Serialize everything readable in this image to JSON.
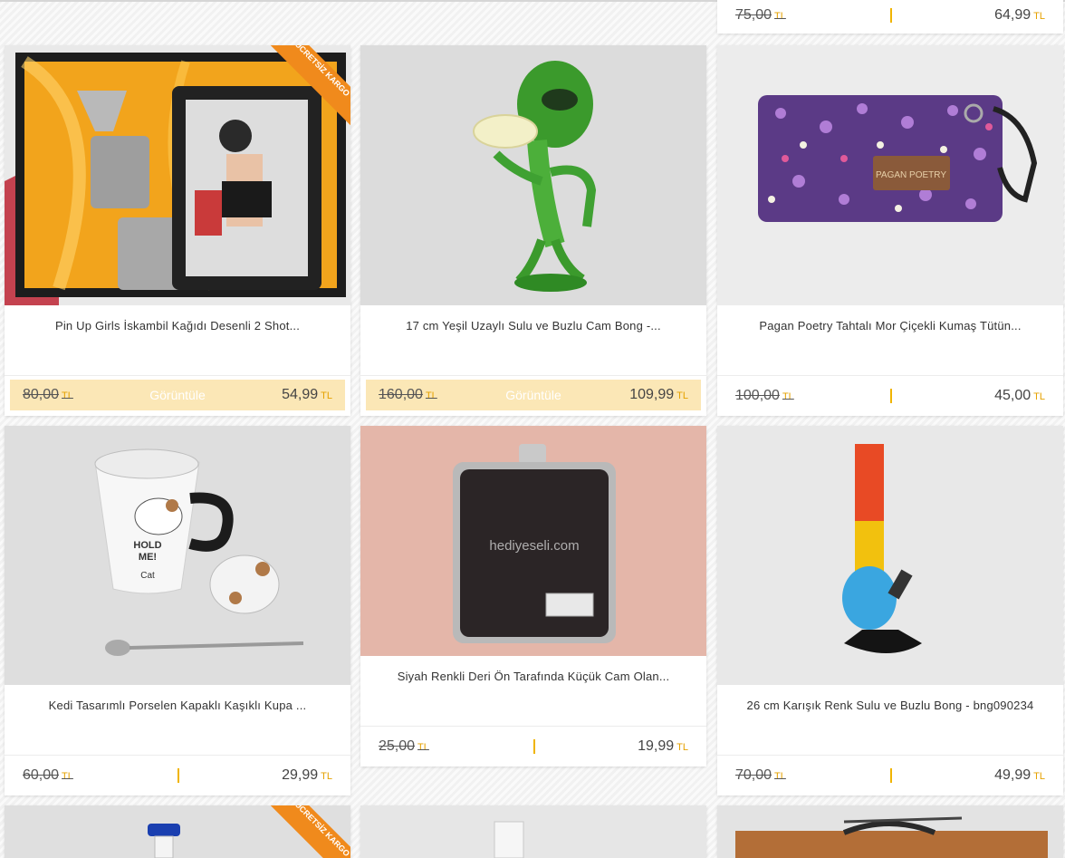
{
  "currency": "TL",
  "view_label": "Görüntüle",
  "ribbon_text": "ÜCRETSİZ KARGO",
  "top_card": {
    "old": "75,00",
    "new": "64,99"
  },
  "products": [
    {
      "title": "Pin Up Girls İskambil Kağıdı Desenli 2 Shot...",
      "old": "80,00",
      "new": "54,99"
    },
    {
      "title": "17 cm Yeşil Uzaylı Sulu ve Buzlu Cam Bong -...",
      "old": "160,00",
      "new": "109,99"
    },
    {
      "title": "Pagan Poetry Tahtalı Mor Çiçekli Kumaş Tütün...",
      "old": "100,00",
      "new": "45,00"
    },
    {
      "title": "Kedi Tasarımlı Porselen Kapaklı Kaşıklı Kupa ...",
      "old": "60,00",
      "new": "29,99"
    },
    {
      "title": "Siyah Renkli Deri Ön Tarafında Küçük Cam Olan...",
      "old": "25,00",
      "new": "19,99"
    },
    {
      "title": "26 cm Karışık Renk Sulu ve Buzlu Bong - bng090234",
      "old": "70,00",
      "new": "49,99"
    }
  ],
  "image_labels": {
    "pouch_patch": "PAGAN POETRY",
    "watermark": "hediyeseli.com",
    "mug_text_1": "HOLD",
    "mug_text_2": "ME!",
    "mug_text_3": "Cat"
  }
}
